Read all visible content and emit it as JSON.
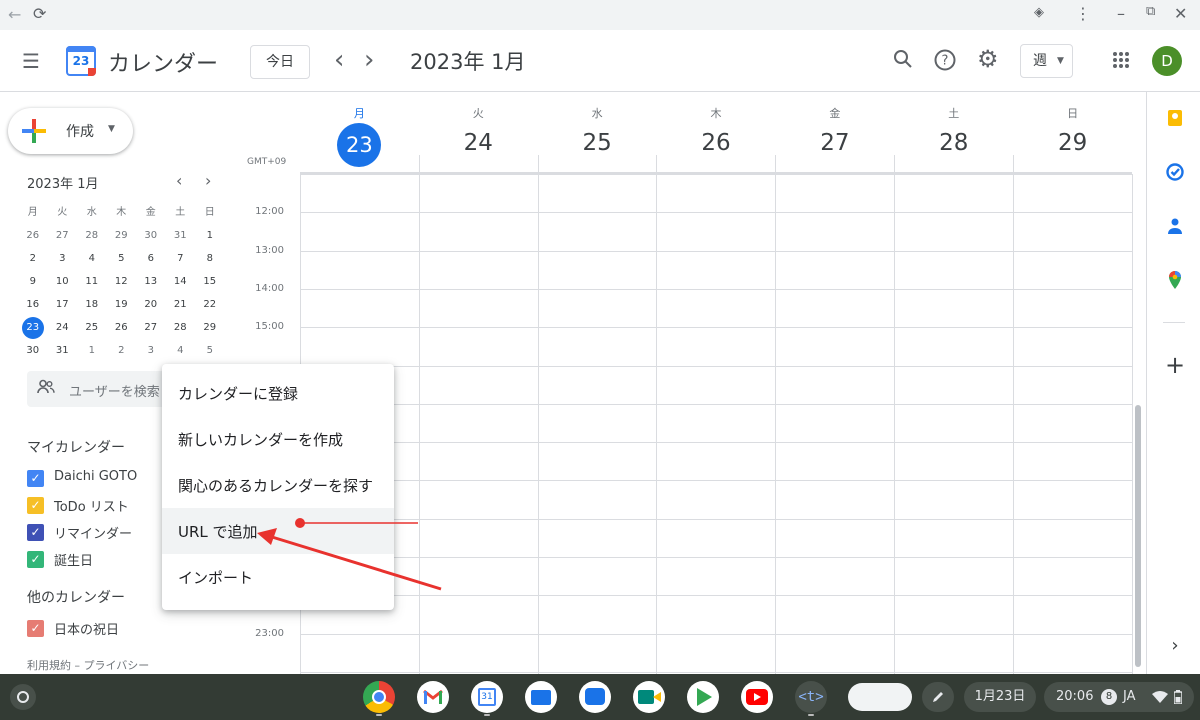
{
  "app": {
    "title": "カレンダー",
    "logo_text": "23"
  },
  "header": {
    "today_label": "今日",
    "prev_icon": "‹",
    "next_icon": "›",
    "date_title": "2023年 1月",
    "view_label": "週",
    "avatar_initial": "D"
  },
  "sidebar": {
    "create_label": "作成",
    "mini_calendar": {
      "title": "2023年 1月",
      "weekdays": [
        "月",
        "火",
        "水",
        "木",
        "金",
        "土",
        "日"
      ],
      "weeks": [
        [
          "26",
          "27",
          "28",
          "29",
          "30",
          "31",
          "1"
        ],
        [
          "2",
          "3",
          "4",
          "5",
          "6",
          "7",
          "8"
        ],
        [
          "9",
          "10",
          "11",
          "12",
          "13",
          "14",
          "15"
        ],
        [
          "16",
          "17",
          "18",
          "19",
          "20",
          "21",
          "22"
        ],
        [
          "23",
          "24",
          "25",
          "26",
          "27",
          "28",
          "29"
        ],
        [
          "30",
          "31",
          "1",
          "2",
          "3",
          "4",
          "5"
        ]
      ],
      "today": "23"
    },
    "search_people_placeholder": "ユーザーを検索",
    "my_calendars_title": "マイカレンダー",
    "my_calendars": [
      {
        "label": "Daichi GOTO",
        "color": "#4285f4"
      },
      {
        "label": "ToDo リスト",
        "color": "#f6bf26"
      },
      {
        "label": "リマインダー",
        "color": "#3f51b5"
      },
      {
        "label": "誕生日",
        "color": "#33b679"
      }
    ],
    "other_calendars_title": "他のカレンダー",
    "other_calendars": [
      {
        "label": "日本の祝日",
        "color": "#e67c73"
      }
    ],
    "footer": "利用規約 – プライバシー"
  },
  "week": {
    "timezone": "GMT+09",
    "days": [
      {
        "name": "月",
        "num": "23",
        "today": true
      },
      {
        "name": "火",
        "num": "24"
      },
      {
        "name": "水",
        "num": "25"
      },
      {
        "name": "木",
        "num": "26"
      },
      {
        "name": "金",
        "num": "27"
      },
      {
        "name": "土",
        "num": "28"
      },
      {
        "name": "日",
        "num": "29"
      }
    ],
    "hours": [
      "12:00",
      "13:00",
      "14:00",
      "15:00",
      "23:00"
    ]
  },
  "context_menu": {
    "items": [
      "カレンダーに登録",
      "新しいカレンダーを作成",
      "関心のあるカレンダーを探す",
      "URL で追加",
      "インポート"
    ],
    "highlighted_index": 3
  },
  "shelf": {
    "date": "1月23日",
    "time": "20:06",
    "notification_count": "8",
    "ime": "JA"
  },
  "colors": {
    "accent": "#1a73e8",
    "annotation_red": "#e8322e"
  }
}
